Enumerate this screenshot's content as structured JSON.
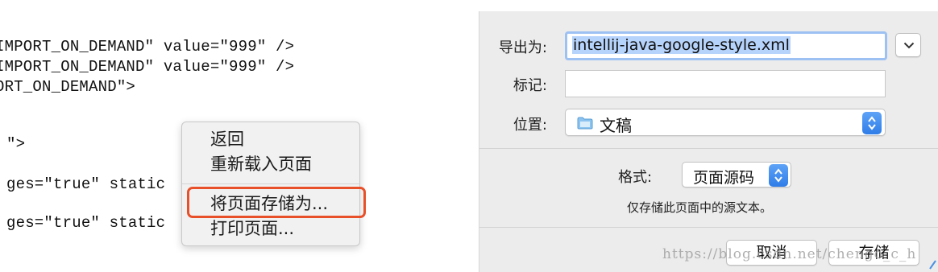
{
  "code": {
    "lines": [
      "IMPORT_ON_DEMAND\" value=\"999\" />",
      "IMPORT_ON_DEMAND\" value=\"999\" />",
      "ORT_ON_DEMAND\">",
      "\">",
      "ges=\"true\" static",
      "ges=\"true\" static"
    ]
  },
  "context_menu": {
    "items": [
      "返回",
      "重新载入页面",
      "将页面存储为...",
      "打印页面..."
    ],
    "highlighted_index": 2,
    "highlight_color": "#e8502a"
  },
  "save_dialog": {
    "export_as_label": "导出为:",
    "filename": "intellij-java-google-style.xml",
    "tags_label": "标记:",
    "tags_value": "",
    "where_label": "位置:",
    "where_value": "文稿",
    "format_label": "格式:",
    "format_value": "页面源码",
    "hint": "仅存储此页面中的源文本。",
    "cancel_label": "取消",
    "save_label": "存储",
    "accent_color": "#3b87f0"
  },
  "watermark": "https://blog.csdn.net/chengo_c_h",
  "icons": [
    "chevron-down-icon",
    "folder-icon",
    "stepper-arrows-icon"
  ]
}
